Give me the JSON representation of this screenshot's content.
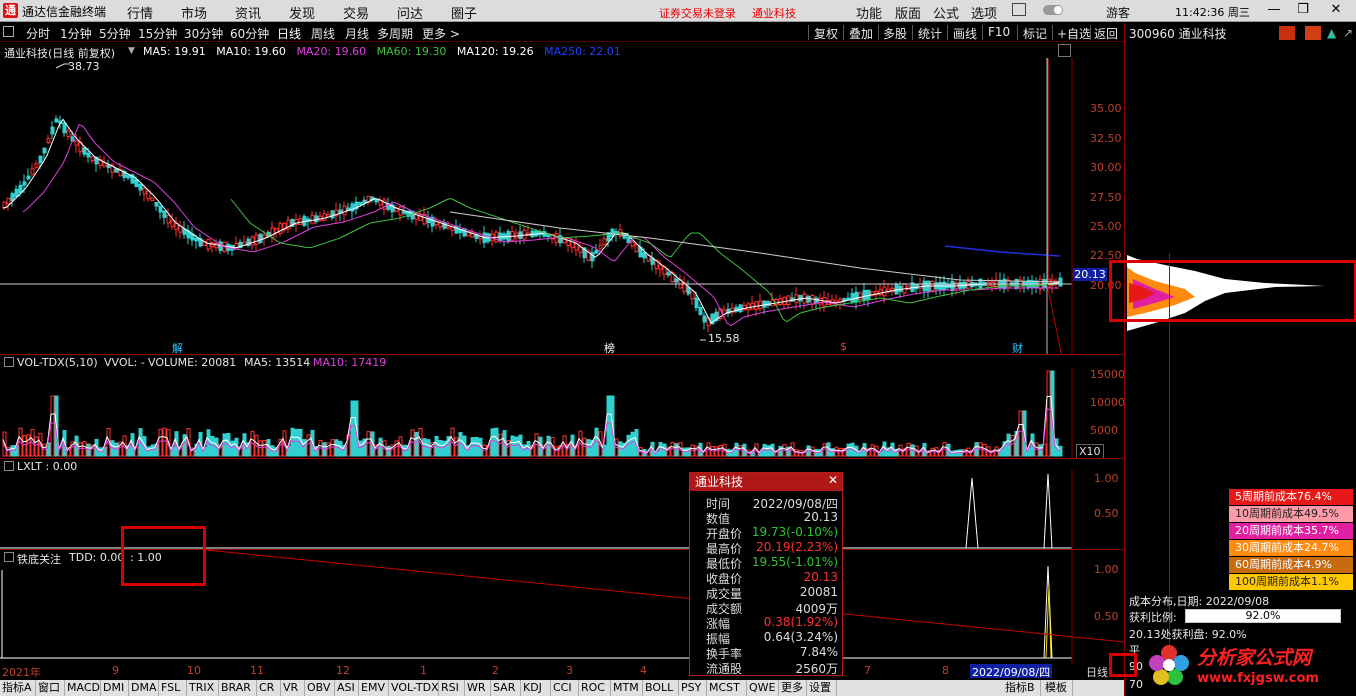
{
  "app": {
    "title": "通达信金融终端",
    "menu": [
      "行情",
      "市场",
      "资讯",
      "发现",
      "交易",
      "问达",
      "圈子"
    ],
    "warning": "证券交易未登录",
    "stock_name": "通业科技",
    "right_menu": [
      "功能",
      "版面",
      "公式",
      "选项"
    ],
    "user": "游客",
    "time": "11:42:36 周三"
  },
  "periods": [
    "分时",
    "1分钟",
    "5分钟",
    "15分钟",
    "30分钟",
    "60分钟",
    "日线",
    "周线",
    "月线",
    "多周期",
    "更多 >"
  ],
  "toolbar_right": [
    "复权",
    "叠加",
    "多股",
    "统计",
    "画线",
    "F10",
    "标记",
    "+自选",
    "返回"
  ],
  "right_panel": {
    "code": "300960 通业科技",
    "cost_labels": [
      "5周期前成本76.4%",
      "10周期前成本49.5%",
      "20周期前成本35.7%",
      "30周期前成本24.7%",
      "60周期前成本4.9%",
      "100周期前成本1.1%"
    ],
    "cost_colors": [
      "#e81818",
      "#ff9aa8",
      "#e020a0",
      "#ff8a10",
      "#c86a10",
      "#ffc800"
    ],
    "dist_date_label": "成本分布,日期: 2022/09/08",
    "profit_label": "获利比例:",
    "profit_value": "92.0%",
    "profit_line": "20.13处获利盘: 92.0%",
    "avg_prefix": "平",
    "bottom_90": "90",
    "bottom_70": "70"
  },
  "main_chart": {
    "title": "通业科技(日线 前复权)",
    "ma": [
      {
        "label": "MA5: 19.91",
        "color": "#ffffff"
      },
      {
        "label": "MA10: 19.60",
        "color": "#ffffff"
      },
      {
        "label": "MA20: 19.60",
        "color": "#e040e0"
      },
      {
        "label": "MA60: 19.30",
        "color": "#40c040"
      },
      {
        "label": "MA120: 19.26",
        "color": "#ffffff"
      },
      {
        "label": "MA250: 22.01",
        "color": "#2040ff"
      }
    ],
    "high_label": "38.73",
    "low_label": "15.58",
    "current_price": "20.13",
    "y_ticks": [
      "35.00",
      "32.50",
      "30.00",
      "27.50",
      "25.00",
      "22.50",
      "20.00"
    ],
    "markers": [
      {
        "text": "解",
        "color": "#2ec5ff"
      },
      {
        "text": "榜",
        "color": "#ffffff"
      },
      {
        "text": "$",
        "color": "#ff3030"
      },
      {
        "text": "财",
        "color": "#2ec5ff"
      }
    ]
  },
  "vol_chart": {
    "title": "VOL-TDX(5,10)",
    "vvol": "VVOL: -",
    "volume": "VOLUME: 20081",
    "ma5": "MA5: 13514",
    "ma10": "MA10: 17419",
    "y_ticks": [
      "15000",
      "10000",
      "5000"
    ],
    "unit": "X10"
  },
  "lxlt": {
    "title": "LXLT : 0.00",
    "y_ticks": [
      "1.00",
      "0.50"
    ]
  },
  "tdd": {
    "title": "铁底关注",
    "value": "TDD: 0.00",
    "value2": ": 1.00",
    "y_ticks": [
      "1.00",
      "0.50"
    ]
  },
  "date_axis": {
    "year": "2021年",
    "months": [
      "9",
      "10",
      "11",
      "12",
      "1",
      "2",
      "3",
      "4",
      "5",
      "6",
      "7",
      "8"
    ],
    "current": "2022/09/08/四",
    "period": "日线"
  },
  "popup": {
    "title": "通业科技",
    "rows": [
      {
        "k": "时间",
        "v": "2022/09/08/四",
        "c": ""
      },
      {
        "k": "数值",
        "v": "20.13",
        "c": ""
      },
      {
        "k": "开盘价",
        "v": "19.73(-0.10%)",
        "c": "green"
      },
      {
        "k": "最高价",
        "v": "20.19(2.23%)",
        "c": "red"
      },
      {
        "k": "最低价",
        "v": "19.55(-1.01%)",
        "c": "green"
      },
      {
        "k": "收盘价",
        "v": "20.13",
        "c": "red"
      },
      {
        "k": "成交量",
        "v": "20081",
        "c": ""
      },
      {
        "k": "成交额",
        "v": "4009万",
        "c": ""
      },
      {
        "k": "涨幅",
        "v": "0.38(1.92%)",
        "c": "red"
      },
      {
        "k": "振幅",
        "v": "0.64(3.24%)",
        "c": ""
      },
      {
        "k": "换手率",
        "v": "7.84%",
        "c": ""
      },
      {
        "k": "流通股",
        "v": "2560万",
        "c": ""
      }
    ]
  },
  "tabs": [
    "指标A",
    "窗口",
    "MACD",
    "DMI",
    "DMA",
    "FSL",
    "TRIX",
    "BRAR",
    "CR",
    "VR",
    "OBV",
    "ASI",
    "EMV",
    "VOL-TDX",
    "RSI",
    "WR",
    "SAR",
    "KDJ",
    "CCI",
    "ROC",
    "MTM",
    "BOLL",
    "PSY",
    "MCST",
    "QWE",
    "更多",
    "设置"
  ],
  "tabs_right": [
    "指标B",
    "模板"
  ],
  "watermark": {
    "title": "分析家公式网",
    "url": "www.fxjgsw.com"
  }
}
